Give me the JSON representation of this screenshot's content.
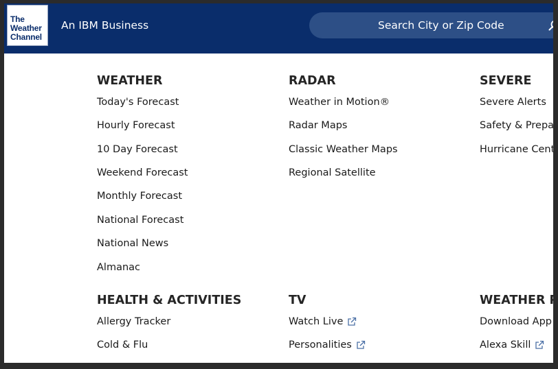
{
  "header": {
    "logo_lines": [
      "The",
      "Weather",
      "Channel"
    ],
    "tagline": "An IBM Business",
    "search_placeholder": "Search City or Zip Code"
  },
  "colors": {
    "header_bg": "#0a2d6b",
    "search_bg": "#2d4f86",
    "link_icon": "#4a6fa5"
  },
  "menu": {
    "weather": {
      "title": "WEATHER",
      "items": [
        "Today's Forecast",
        "Hourly Forecast",
        "10 Day Forecast",
        "Weekend Forecast",
        "Monthly Forecast",
        "National Forecast",
        "National News",
        "Almanac"
      ]
    },
    "radar": {
      "title": "RADAR",
      "items": [
        "Weather in Motion®",
        "Radar Maps",
        "Classic Weather Maps",
        "Regional Satellite"
      ]
    },
    "severe": {
      "title": "SEVERE",
      "items": [
        "Severe Alerts",
        "Safety & Prepa",
        "Hurricane Cent"
      ]
    },
    "health": {
      "title": "HEALTH & ACTIVITIES",
      "items": [
        "Allergy Tracker",
        "Cold & Flu"
      ]
    },
    "tv": {
      "title": "TV",
      "items": [
        "Watch Live",
        "Personalities"
      ]
    },
    "weather_products": {
      "title": "WEATHER PR",
      "items": [
        "Download App",
        "Alexa Skill"
      ]
    }
  },
  "icons": {
    "search": "search-icon",
    "external": "external-link-icon"
  }
}
